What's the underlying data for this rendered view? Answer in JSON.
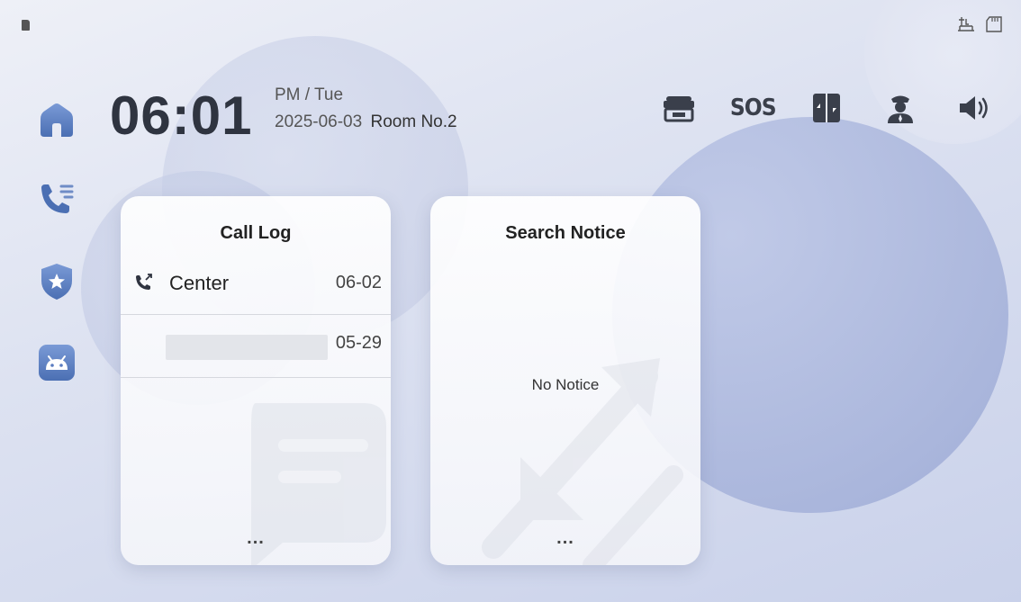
{
  "header": {
    "time": "06:01",
    "ampm_day": "PM / Tue",
    "date": "2025-06-03",
    "room": "Room No.2"
  },
  "sidebar": {
    "items": [
      {
        "icon": "home-icon",
        "active": true
      },
      {
        "icon": "call-log-icon"
      },
      {
        "icon": "shield-star-icon"
      },
      {
        "icon": "android-icon"
      }
    ]
  },
  "toolbar": {
    "items": [
      {
        "icon": "elevator-icon"
      },
      {
        "icon": "sos-icon",
        "label": "SOS"
      },
      {
        "icon": "door-icon"
      },
      {
        "icon": "guard-icon"
      },
      {
        "icon": "volume-icon"
      }
    ]
  },
  "call_log": {
    "title": "Call Log",
    "entries": [
      {
        "name": "Center",
        "date": "06-02"
      },
      {
        "name": "",
        "date": "05-29"
      }
    ],
    "more": "..."
  },
  "notice": {
    "title": "Search Notice",
    "empty_text": "No Notice",
    "more": "..."
  },
  "colors": {
    "accent": "#4b6fb3",
    "accent_light": "#7a9ad6",
    "text_dark": "#2f3440"
  }
}
